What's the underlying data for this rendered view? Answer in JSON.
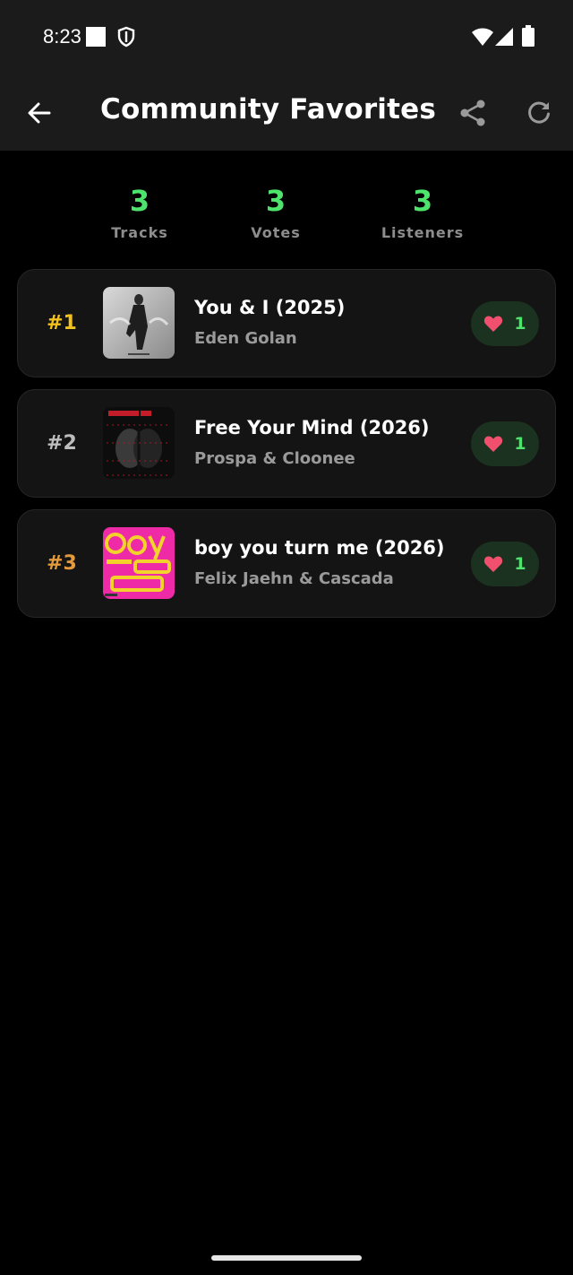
{
  "status_bar": {
    "time": "8:23"
  },
  "header": {
    "title": "Community Favorites"
  },
  "stats": [
    {
      "value": "3",
      "label": "Tracks"
    },
    {
      "value": "3",
      "label": "Votes"
    },
    {
      "value": "3",
      "label": "Listeners"
    }
  ],
  "tracks": [
    {
      "rank": "#1",
      "title": "You & I (2025)",
      "artist": "Eden Golan",
      "votes": "1"
    },
    {
      "rank": "#2",
      "title": "Free Your Mind (2026)",
      "artist": "Prospa & Cloonee",
      "votes": "1"
    },
    {
      "rank": "#3",
      "title": "boy you turn me (2026)",
      "artist": "Felix Jaehn & Cascada",
      "votes": "1"
    }
  ],
  "colors": {
    "accent_green": "#4ee36d",
    "rank_gold": "#f2c21b",
    "rank_silver": "#bdbdbd",
    "rank_bronze": "#e39a3a",
    "heart": "#f0506e"
  },
  "icons": {
    "back": "arrow-left-icon",
    "share": "share-icon",
    "refresh": "refresh-icon",
    "vote": "heart-icon"
  }
}
